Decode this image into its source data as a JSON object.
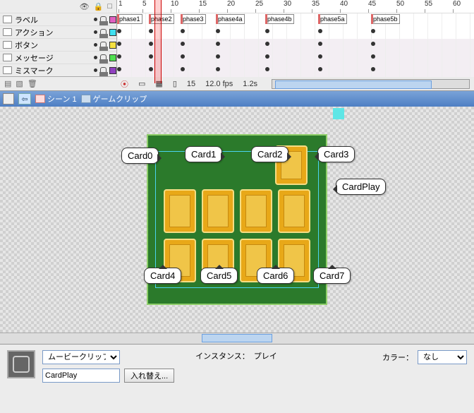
{
  "timeline": {
    "ticks": [
      "1",
      "5",
      "10",
      "15",
      "20",
      "25",
      "30",
      "35",
      "40",
      "45",
      "50",
      "55",
      "60"
    ],
    "layers": [
      {
        "name": "ラベル",
        "color": "#e060c0",
        "flags": [
          {
            "l": 0,
            "t": "phase1"
          },
          {
            "l": 45,
            "t": "phase2"
          },
          {
            "l": 90,
            "t": "phase3"
          },
          {
            "l": 140,
            "t": "phase4a"
          },
          {
            "l": 210,
            "t": "phase4b"
          },
          {
            "l": 285,
            "t": "phase5a"
          },
          {
            "l": 360,
            "t": "phase5b"
          }
        ]
      },
      {
        "name": "アクション",
        "color": "#40e0f0"
      },
      {
        "name": "ボタン",
        "color": "#f5e040"
      },
      {
        "name": "メッセージ",
        "color": "#50e050"
      },
      {
        "name": "ミスマーク",
        "color": "#9040c0"
      }
    ],
    "foot": {
      "frame": "15",
      "fps": "12.0 fps",
      "time": "1.2s"
    }
  },
  "breadcrumb": {
    "scene": "シーン 1",
    "clip": "ゲームクリップ"
  },
  "callouts": {
    "c0": "Card0",
    "c1": "Card1",
    "c2": "Card2",
    "c3": "Card3",
    "c4": "Card4",
    "c5": "Card5",
    "c6": "Card6",
    "c7": "Card7",
    "cp": "CardPlay"
  },
  "props": {
    "type": "ムービークリップ",
    "instanceName": "CardPlay",
    "swapBtn": "入れ替え...",
    "instanceLabel": "インスタンス：",
    "instanceVal": "プレイ",
    "colorLabel": "カラー：",
    "colorVal": "なし"
  }
}
